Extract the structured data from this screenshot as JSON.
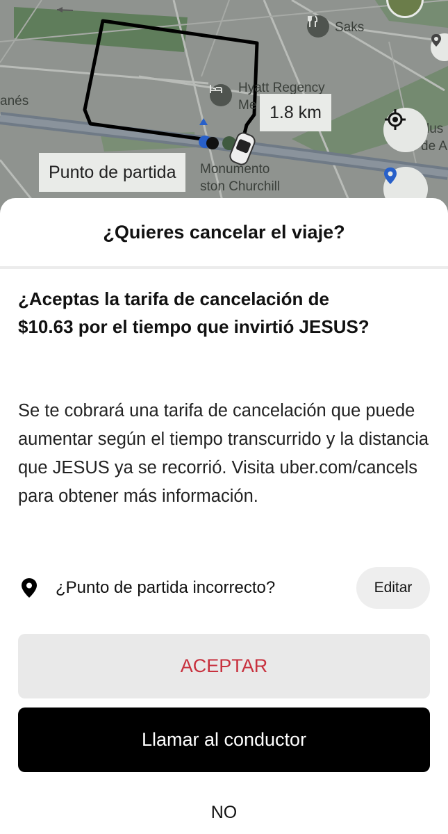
{
  "map": {
    "poi_saks": "Saks",
    "poi_hyatt_line1": "Hyatt Regency",
    "poi_hyatt_line2": "Me",
    "poi_anes": "anés",
    "poi_monumento_line1": "Monumento",
    "poi_monumento_line2": "ston Churchill",
    "poi_museo_line1": "lus",
    "poi_museo_line2": "de A",
    "distance": "1.8 km",
    "pickup_chip": "Punto de partida",
    "route_color": "#000000",
    "icons": [
      "restaurant-icon",
      "hotel-icon",
      "taxi-car-icon",
      "recenter-icon",
      "location-pin-icon"
    ]
  },
  "sheet": {
    "title": "¿Quieres cancelar el viaje?",
    "question": "¿Aceptas la tarifa de cancelación de $10.63 por el tiempo que invirtió JESUS?",
    "info": "Se te cobrará una tarifa de cancelación que puede aumentar según el tiempo transcurrido y la distancia que JESUS ya se recorrió. Visita uber.com/cancels para obtener más información.",
    "pickup_prompt": "¿Punto de partida incorrecto?",
    "edit_label": "Editar",
    "accept_label": "ACEPTAR",
    "call_label": "Llamar al conductor",
    "no_label": "NO",
    "accent_color": "#c8313e"
  }
}
